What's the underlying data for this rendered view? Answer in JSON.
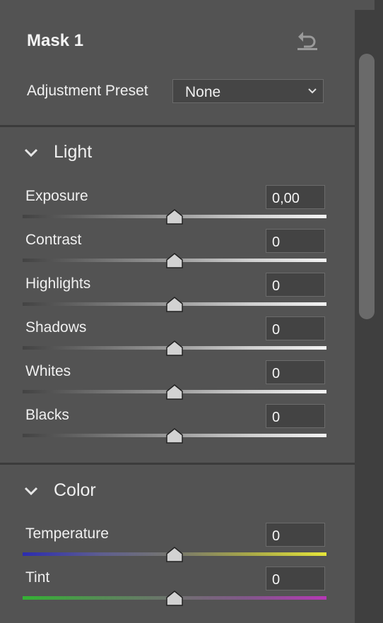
{
  "mask": {
    "title": "Mask 1"
  },
  "preset": {
    "label": "Adjustment Preset",
    "value": "None"
  },
  "sections": {
    "light": {
      "title": "Light"
    },
    "color": {
      "title": "Color"
    }
  },
  "light": {
    "exposure": {
      "label": "Exposure",
      "value": "0,00"
    },
    "contrast": {
      "label": "Contrast",
      "value": "0"
    },
    "highlights": {
      "label": "Highlights",
      "value": "0"
    },
    "shadows": {
      "label": "Shadows",
      "value": "0"
    },
    "whites": {
      "label": "Whites",
      "value": "0"
    },
    "blacks": {
      "label": "Blacks",
      "value": "0"
    }
  },
  "color": {
    "temperature": {
      "label": "Temperature",
      "value": "0"
    },
    "tint": {
      "label": "Tint",
      "value": "0"
    }
  },
  "slider_positions": {
    "exposure": 0.5,
    "contrast": 0.5,
    "highlights": 0.5,
    "shadows": 0.5,
    "whites": 0.5,
    "blacks": 0.5,
    "temperature": 0.5,
    "tint": 0.5
  },
  "icons": {
    "reset": "reset-icon",
    "dropdown": "chevron-down-icon",
    "section_toggle": "chevron-down-icon"
  },
  "colors": {
    "panel_bg": "#535353",
    "field_bg": "#434343",
    "text": "#f0f0f0"
  }
}
